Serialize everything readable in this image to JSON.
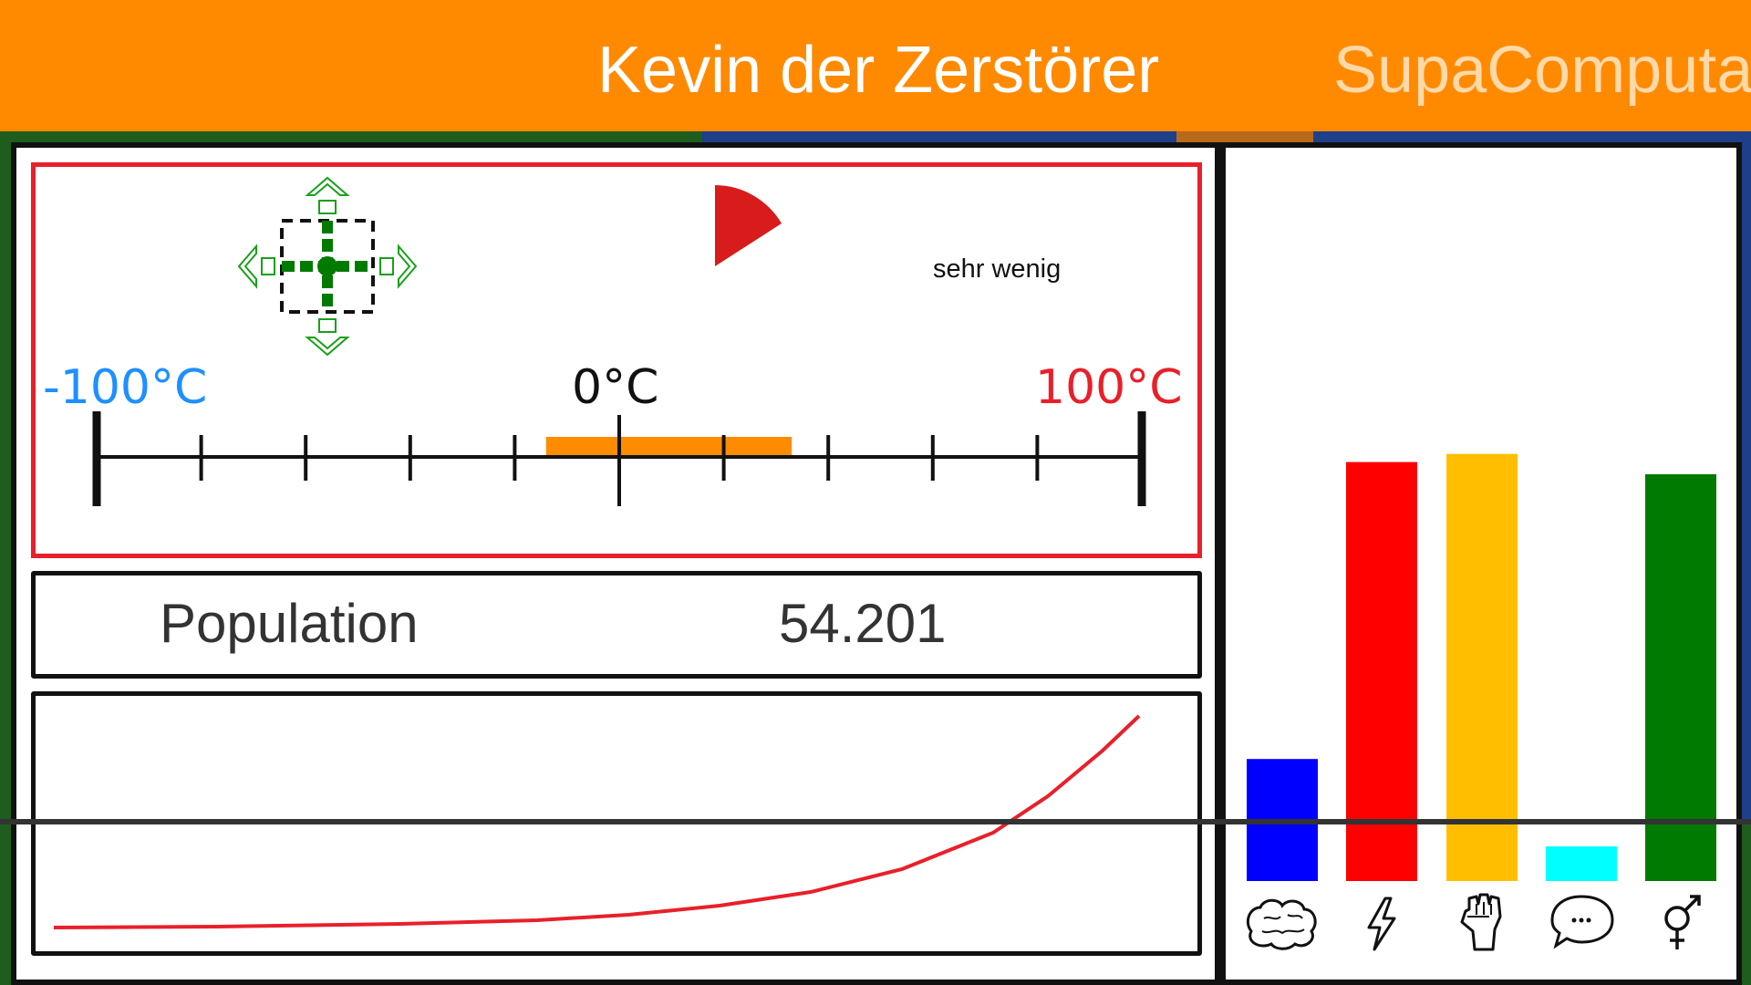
{
  "header": {
    "title": "Kevin der Zerstörer",
    "subtitle": "SupaComputa"
  },
  "temperature": {
    "min_label": "-100°C",
    "mid_label": "0°C",
    "max_label": "100°C",
    "amount_label": "sehr wenig",
    "scale_min": -100,
    "scale_max": 100,
    "tick_step": 20,
    "range_low": -14,
    "range_high": 33
  },
  "population": {
    "label": "Population",
    "value": "54.201"
  },
  "colors": {
    "bar_brain": "#0000ff",
    "bar_energy": "#ff0000",
    "bar_strength": "#ffbf00",
    "bar_speech": "#00ffff",
    "bar_gender": "#007a00",
    "curve": "#e8202a",
    "range": "#ff8c00"
  },
  "stats": [
    {
      "icon": "brain-icon",
      "level": 0.3
    },
    {
      "icon": "lightning-icon",
      "level": 1.03
    },
    {
      "icon": "fist-icon",
      "level": 1.05
    },
    {
      "icon": "speech-bubble-icon",
      "level": 0.085
    },
    {
      "icon": "gender-symbol-icon",
      "level": 1.0
    }
  ]
}
